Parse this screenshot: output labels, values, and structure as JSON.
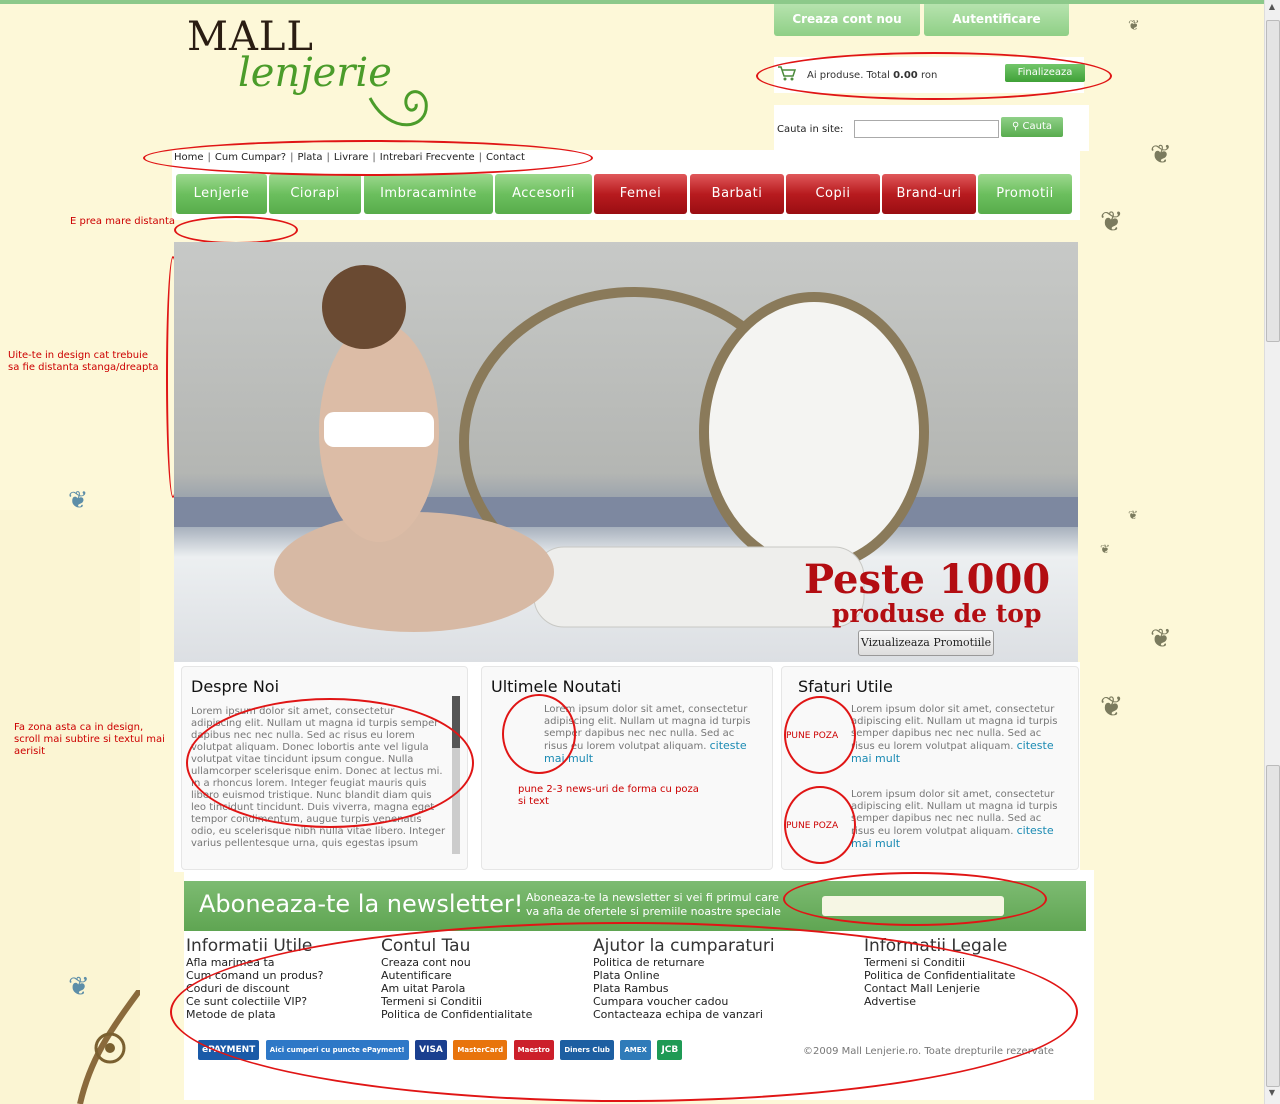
{
  "header": {
    "logo_top": "MALL",
    "logo_bottom": "lenjerie",
    "btn_create": "Creaza cont nou",
    "btn_login": "Autentificare"
  },
  "cart": {
    "prefix": "Ai produse. Total ",
    "amount": "0.00",
    "suffix": " ron",
    "finalize": "Finalizeaza"
  },
  "search": {
    "label": "Cauta in site:",
    "value": "",
    "button": "Cauta"
  },
  "topnav": [
    "Home",
    "Cum Cumpar?",
    "Plata",
    "Livrare",
    "Intrebari Frecvente",
    "Contact"
  ],
  "menu": [
    {
      "label": "Lenjerie",
      "color": "green"
    },
    {
      "label": "Ciorapi",
      "color": "green"
    },
    {
      "label": "Imbracaminte",
      "color": "green"
    },
    {
      "label": "Accesorii",
      "color": "green"
    },
    {
      "label": "Femei",
      "color": "red"
    },
    {
      "label": "Barbati",
      "color": "red"
    },
    {
      "label": "Copii",
      "color": "red"
    },
    {
      "label": "Brand-uri",
      "color": "red"
    },
    {
      "label": "Promotii",
      "color": "green"
    }
  ],
  "annotations": {
    "distance": "E prea mare distanta",
    "margins_1": "Uite-te in design cat trebuie",
    "margins_2": "sa fie distanta stanga/dreapta",
    "zone_1": "Fa zona asta ca in design,",
    "zone_2": "scroll mai subtire si textul mai",
    "zone_3": "aerisit",
    "news_1": "pune 2-3 news-uri de forma cu poza",
    "news_2": "si text",
    "photo": "PUNE POZA"
  },
  "hero": {
    "title": "Peste 1000",
    "subtitle": "produse de top",
    "button": "Vizualizeaza Promotiile"
  },
  "about": {
    "title": "Despre Noi",
    "text": "Lorem ipsum dolor sit amet, consectetur adipiscing elit. Nullam ut magna id turpis semper dapibus nec nec nulla. Sed ac risus eu lorem volutpat aliquam. Donec lobortis ante vel ligula volutpat vitae tincidunt ipsum congue. Nulla ullamcorper scelerisque enim. Donec at lectus mi. In a rhoncus lorem. Integer feugiat mauris quis libero euismod tristique. Nunc blandit diam quis leo tincidunt tincidunt. Duis viverra, magna eget tempor condimentum, augue turpis venenatis odio, eu scelerisque nibh nulla vitae libero. Integer varius pellentesque urna, quis egestas ipsum"
  },
  "news": {
    "title": "Ultimele Noutati",
    "text": "Lorem ipsum dolor sit amet, consectetur adipiscing elit. Nullam ut magna id turpis semper dapibus nec nec nulla. Sed ac risus eu lorem volutpat aliquam.",
    "more": "citeste mai mult"
  },
  "tips": {
    "title": "Sfaturi Utile",
    "text": "Lorem ipsum dolor sit amet, consectetur adipiscing elit. Nullam ut magna id turpis semper dapibus nec nec nulla. Sed ac risus eu lorem volutpat aliquam.",
    "more": "citeste mai mult"
  },
  "newsletter": {
    "title": "Aboneaza-te la newsletter!",
    "text_1": "Aboneaza-te la newsletter si vei fi primul care",
    "text_2": "va afla de ofertele si premiile noastre speciale",
    "input_value": ""
  },
  "footer": {
    "columns": [
      {
        "title": "Informatii Utile",
        "links": [
          "Afla marimea ta",
          "Cum comand un produs?",
          "Coduri de discount",
          "Ce sunt colectiile VIP?",
          "Metode de plata"
        ]
      },
      {
        "title": "Contul Tau",
        "links": [
          "Creaza cont nou",
          "Autentificare",
          "Am uitat Parola",
          "Termeni si Conditii",
          "Politica de Confidentialitate"
        ]
      },
      {
        "title": "Ajutor la cumparaturi",
        "links": [
          "Politica de returnare",
          "Plata Online",
          "Plata Rambus",
          "Cumpara voucher cadou",
          "Contacteaza echipa de vanzari"
        ]
      },
      {
        "title": "Informatii Legale",
        "links": [
          "Termeni si Conditii",
          "Politica de Confidentialitate",
          "Contact Mall Lenjerie",
          "Advertise"
        ]
      }
    ],
    "copyright": "©2009 Mall Lenjerie.ro. Toate drepturile rezervate",
    "payments": [
      "ePAYMENT",
      "Aici cumperi cu puncte ePayment!",
      "VISA",
      "MasterCard",
      "Maestro",
      "Diners Club",
      "AMEX",
      "JCB"
    ]
  }
}
